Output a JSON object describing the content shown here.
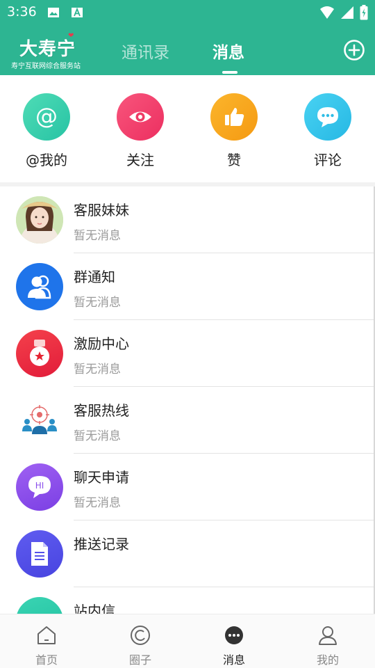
{
  "status_bar": {
    "time": "3:36"
  },
  "header": {
    "logo_text": "大寿宁",
    "logo_subtitle": "寿宁互联网综合服务站",
    "tabs": [
      {
        "label": "通讯录",
        "active": false
      },
      {
        "label": "消息",
        "active": true
      }
    ],
    "add_icon": "plus-circle-icon"
  },
  "quick_actions": [
    {
      "label": "@我的",
      "icon": "at-icon",
      "color": "#3ccfa6"
    },
    {
      "label": "关注",
      "icon": "eye-icon",
      "color": "#f0406e"
    },
    {
      "label": "赞",
      "icon": "thumbs-up-icon",
      "color": "#f7a21a"
    },
    {
      "label": "评论",
      "icon": "comment-icon",
      "color": "#36c4ea"
    }
  ],
  "messages": [
    {
      "title": "客服妹妹",
      "subtitle": "暂无消息",
      "avatar": "customer-service-photo"
    },
    {
      "title": "群通知",
      "subtitle": "暂无消息",
      "avatar": "group-icon"
    },
    {
      "title": "激励中心",
      "subtitle": "暂无消息",
      "avatar": "medal-icon"
    },
    {
      "title": "客服热线",
      "subtitle": "暂无消息",
      "avatar": "hotline-icon"
    },
    {
      "title": "聊天申请",
      "subtitle": "暂无消息",
      "avatar": "chat-hi-icon"
    },
    {
      "title": "推送记录",
      "subtitle": "",
      "avatar": "document-icon"
    },
    {
      "title": "站内信",
      "subtitle": "",
      "avatar": "mail-icon"
    }
  ],
  "bottom_nav": [
    {
      "label": "首页",
      "icon": "home-icon",
      "active": false
    },
    {
      "label": "圈子",
      "icon": "circle-icon",
      "active": false
    },
    {
      "label": "消息",
      "icon": "message-icon",
      "active": true
    },
    {
      "label": "我的",
      "icon": "profile-icon",
      "active": false
    }
  ],
  "colors": {
    "brand": "#2db592"
  }
}
